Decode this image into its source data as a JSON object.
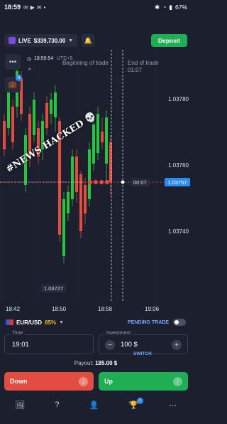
{
  "status": {
    "time": "18:59",
    "battery": "67%"
  },
  "account": {
    "mode": "LIVE",
    "balance": "$339,730.00",
    "deposit_label": "Deposit"
  },
  "chart": {
    "timer": "18:59:54",
    "utc": "UTC+5",
    "beginning_label": "Beginning of trade",
    "end_label": "End of trade",
    "end_time": "01:07",
    "countdown": "00:07",
    "current_price": "1.03757",
    "low_price": "1.03727",
    "price_ticks": [
      "1.03780",
      "1.03760",
      "1.03740"
    ],
    "time_ticks": [
      "18:42",
      "18:50",
      "18:58",
      "19:06"
    ],
    "overlay_text": "#NEWS HACKED",
    "badge_count": "4"
  },
  "trade": {
    "pair": "EUR/USD",
    "payout_pct": "85%",
    "pending_label": "PENDING TRADE",
    "time_label": "Time",
    "time_value": "19:01",
    "investment_label": "Investment",
    "investment_value": "100 $",
    "switch_label": "SWITCH",
    "payout_label": "Payout:",
    "payout_value": "185.00 $",
    "down_label": "Down",
    "up_label": "Up"
  },
  "nav": {
    "badge": "4"
  }
}
